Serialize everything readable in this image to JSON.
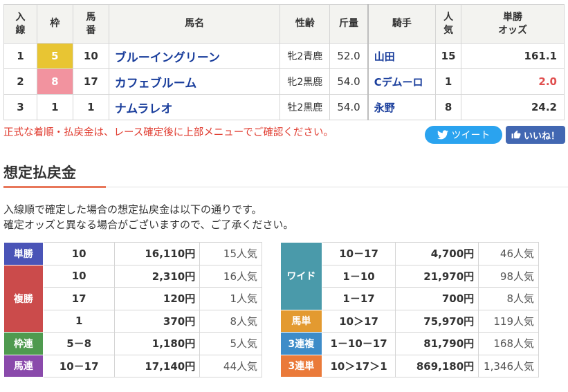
{
  "results": {
    "headers": {
      "rank": [
        "入",
        "線"
      ],
      "waku": "枠",
      "num": [
        "馬",
        "番"
      ],
      "horse": "馬名",
      "sex": "性齢",
      "weight": "斤量",
      "jockey": "騎手",
      "pop": [
        "人",
        "気"
      ],
      "odds": [
        "単勝",
        "オッズ"
      ]
    },
    "rows": [
      {
        "rank": "1",
        "waku": "5",
        "num": "10",
        "horse": "ブルーイングリーン",
        "sex": "牝2青鹿",
        "weight": "52.0",
        "jockey": "山田",
        "pop": "15",
        "odds": "161.1"
      },
      {
        "rank": "2",
        "waku": "8",
        "num": "17",
        "horse": "カフェブルーム",
        "sex": "牝2黒鹿",
        "weight": "54.0",
        "jockey": "Cデムーロ",
        "pop": "1",
        "odds": "2.0"
      },
      {
        "rank": "3",
        "waku": "1",
        "num": "1",
        "horse": "ナムラレオ",
        "sex": "牡2黒鹿",
        "weight": "54.0",
        "jockey": "永野",
        "pop": "8",
        "odds": "24.2"
      }
    ]
  },
  "notice": "正式な着順・払戻金は、レース確定後に上部メニューでご確認ください。",
  "social": {
    "tweet": "ツイート",
    "like": "いいね！"
  },
  "section": {
    "title": "想定払戻金",
    "intro_line1": "入線順で確定した場合の想定払戻金は以下の通りです。",
    "intro_line2": "確定オッズと異なる場合がございますので、ご了承ください。"
  },
  "payouts_left": {
    "tansho": {
      "label": "単勝",
      "rows": [
        {
          "combo": "10",
          "amount": "16,110円",
          "pop": "15人気"
        }
      ]
    },
    "fukusho": {
      "label": "複勝",
      "rows": [
        {
          "combo": "10",
          "amount": "2,310円",
          "pop": "16人気"
        },
        {
          "combo": "17",
          "amount": "120円",
          "pop": "1人気"
        },
        {
          "combo": "1",
          "amount": "370円",
          "pop": "8人気"
        }
      ]
    },
    "wakuren": {
      "label": "枠連",
      "rows": [
        {
          "combo": "5－8",
          "amount": "1,180円",
          "pop": "5人気"
        }
      ]
    },
    "umaren": {
      "label": "馬連",
      "rows": [
        {
          "combo": "10－17",
          "amount": "17,140円",
          "pop": "44人気"
        }
      ]
    }
  },
  "payouts_right": {
    "wide": {
      "label": "ワイド",
      "rows": [
        {
          "combo": "10－17",
          "amount": "4,700円",
          "pop": "46人気"
        },
        {
          "combo": "1－10",
          "amount": "21,970円",
          "pop": "98人気"
        },
        {
          "combo": "1－17",
          "amount": "700円",
          "pop": "8人気"
        }
      ]
    },
    "umatan": {
      "label": "馬単",
      "rows": [
        {
          "combo": "10＞17",
          "amount": "75,970円",
          "pop": "119人気"
        }
      ]
    },
    "sanrenpuku": {
      "label": "3連複",
      "rows": [
        {
          "combo": "1－10－17",
          "amount": "81,790円",
          "pop": "168人気"
        }
      ]
    },
    "sanrentan": {
      "label": "3連単",
      "rows": [
        {
          "combo": "10＞17＞1",
          "amount": "869,180円",
          "pop": "1,346人気"
        }
      ]
    }
  },
  "colors": {
    "tansho": "#4a54b7",
    "fukusho": "#cb4b4b",
    "wakuren": "#4f9a4f",
    "umaren": "#8a4aab",
    "wide": "#4a9aaa",
    "umatan": "#e39a30",
    "sanrenpuku": "#3e8cc8",
    "sanrentan": "#ea7a3a",
    "waku5": "#e8c533",
    "waku8": "#f2939f",
    "link": "#1a3e9c",
    "notice": "#e03a2e"
  }
}
